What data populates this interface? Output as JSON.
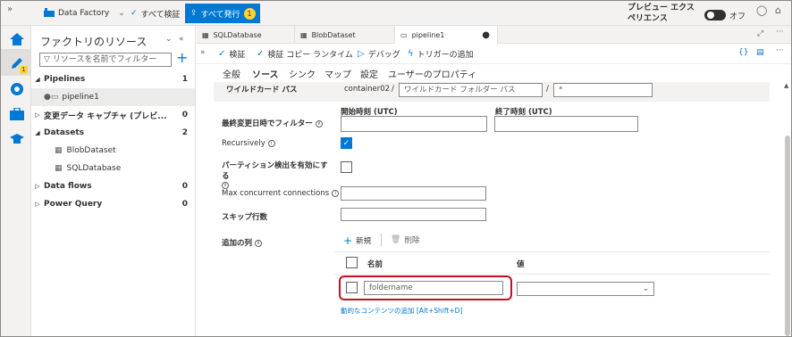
{
  "topbar": {
    "collapse_label": "»",
    "factory_name": "Data Factory",
    "validate_all": "すべて検証",
    "publish_all": "すべて発行",
    "publish_count": "1",
    "preview_label": "プレビュー エクスペリエンス",
    "toggle_label": "オフ"
  },
  "resources": {
    "title": "ファクトリのリソース",
    "filter_placeholder": "リソースを名前でフィルター",
    "tree": [
      {
        "label": "Pipelines",
        "count": "1",
        "expanded": true
      },
      {
        "label": "pipeline1",
        "child": true
      },
      {
        "label": "変更データ キャプチャ (プレビ...",
        "count": "0",
        "expanded": false
      },
      {
        "label": "Datasets",
        "count": "2",
        "expanded": true
      },
      {
        "label": "BlobDataset",
        "child": true
      },
      {
        "label": "SQLDatabase",
        "child": true
      },
      {
        "label": "Data flows",
        "count": "0",
        "expanded": false
      },
      {
        "label": "Power Query",
        "count": "0",
        "expanded": false
      }
    ]
  },
  "tabs": [
    {
      "label": "SQLDatabase"
    },
    {
      "label": "BlobDataset"
    },
    {
      "label": "pipeline1",
      "active": true,
      "dirty": "●"
    }
  ],
  "toolbar": {
    "validate": "検証",
    "validate_copy": "検証 コピー ランタイム",
    "debug": "デバッグ",
    "add_trigger": "トリガーの追加"
  },
  "subtabs": [
    "全般",
    "ソース",
    "シンク",
    "マップ",
    "設定",
    "ユーザーのプロパティ"
  ],
  "form": {
    "wildcard_label": "ワイルドカード パス",
    "container": "container02",
    "slash1": "/",
    "wildcard_folder_placeholder": "ワイルドカード フォルダー パス",
    "slash2": "/",
    "wildcard_file": "*",
    "start_time_label": "開始時刻 (UTC)",
    "end_time_label": "終了時刻 (UTC)",
    "last_modified_label": "最終変更日時でフィルター",
    "recursively_label": "Recursively",
    "recursively_checked": true,
    "partition_label": "パーティション検出を有効にする",
    "max_conn_label": "Max concurrent connections",
    "skip_rows_label": "スキップ行数",
    "additional_columns_label": "追加の列",
    "new_button": "新規",
    "delete_button": "削除",
    "col_name_header": "名前",
    "col_value_header": "値",
    "column_name_value": "foldername",
    "dynamic_content_link": "動的なコンテンツの追加 [Alt+Shift+D]"
  },
  "colors": {
    "accent": "#0078d4",
    "highlight": "#c50f1f",
    "badge": "#ffd335"
  }
}
